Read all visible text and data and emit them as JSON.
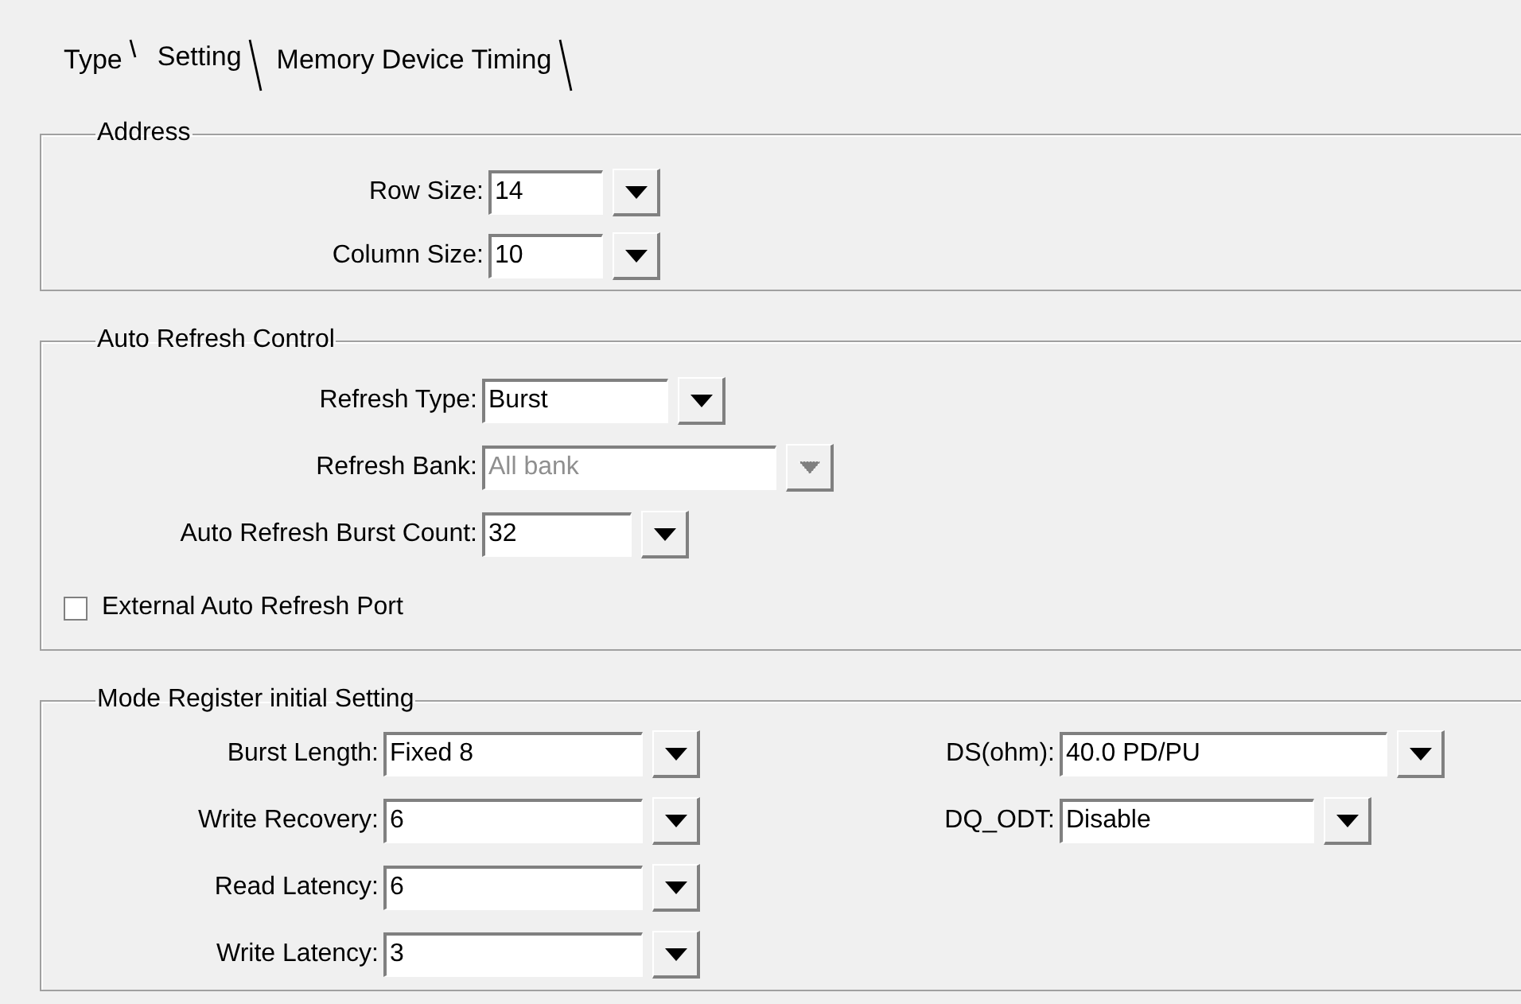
{
  "tabs": [
    {
      "label": "Type"
    },
    {
      "label": "Setting"
    },
    {
      "label": "Memory Device Timing"
    }
  ],
  "groups": [
    {
      "title": "Address",
      "columns": [
        [
          {
            "kind": "combo",
            "label": "Row Size:",
            "value": "14",
            "disabled": false
          },
          {
            "kind": "combo",
            "label": "Column Size:",
            "value": "10",
            "disabled": false
          }
        ]
      ]
    },
    {
      "title": "Auto Refresh Control",
      "columns": [
        [
          {
            "kind": "combo",
            "label": "Refresh Type:",
            "value": "Burst",
            "disabled": false
          },
          {
            "kind": "combo",
            "label": "Refresh Bank:",
            "value": "All bank",
            "disabled": true
          },
          {
            "kind": "combo",
            "label": "Auto Refresh Burst Count:",
            "value": "32",
            "disabled": false
          },
          {
            "kind": "checkbox",
            "label": "External Auto Refresh Port",
            "checked": false
          }
        ]
      ]
    },
    {
      "title": "Mode Register initial Setting",
      "columns": [
        [
          {
            "kind": "combo",
            "label": "Burst Length:",
            "value": "Fixed 8",
            "disabled": false
          },
          {
            "kind": "combo",
            "label": "Write Recovery:",
            "value": "6",
            "disabled": false
          },
          {
            "kind": "combo",
            "label": "Read Latency:",
            "value": "6",
            "disabled": false
          },
          {
            "kind": "combo",
            "label": "Write Latency:",
            "value": "3",
            "disabled": false
          }
        ],
        [
          {
            "kind": "combo",
            "label": "DS(ohm):",
            "value": "40.0 PD/PU",
            "disabled": false
          },
          {
            "kind": "combo",
            "label": "DQ_ODT:",
            "value": "Disable",
            "disabled": false
          }
        ]
      ]
    }
  ]
}
